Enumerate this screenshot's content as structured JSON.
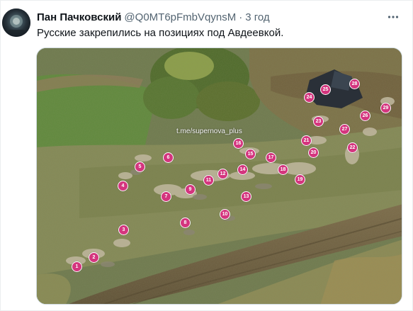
{
  "tweet": {
    "display_name": "Пан Пачковский",
    "handle": "@Q0MT6pFmbVqynsM",
    "separator": "·",
    "time": "3 год",
    "text": "Русские закрепились на позициях под Авдеевкой.",
    "more_icon": "more-dots-icon"
  },
  "media": {
    "watermark": "t.me/supernova_plus",
    "markers": [
      {
        "label": "1"
      },
      {
        "label": "2"
      },
      {
        "label": "3"
      },
      {
        "label": "4"
      },
      {
        "label": "5"
      },
      {
        "label": "6"
      },
      {
        "label": "7"
      },
      {
        "label": "8"
      },
      {
        "label": "9"
      },
      {
        "label": "10"
      },
      {
        "label": "11"
      },
      {
        "label": "12"
      },
      {
        "label": "13"
      },
      {
        "label": "14"
      },
      {
        "label": "15"
      },
      {
        "label": "16"
      },
      {
        "label": "17"
      },
      {
        "label": "18"
      },
      {
        "label": "19"
      },
      {
        "label": "20"
      },
      {
        "label": "21"
      },
      {
        "label": "22"
      },
      {
        "label": "23"
      },
      {
        "label": "24"
      },
      {
        "label": "25"
      },
      {
        "label": "26"
      },
      {
        "label": "27"
      },
      {
        "label": "28"
      },
      {
        "label": "29"
      }
    ]
  },
  "colors": {
    "marker": "#d4357e",
    "text": "#0f1419",
    "secondary": "#536471"
  }
}
